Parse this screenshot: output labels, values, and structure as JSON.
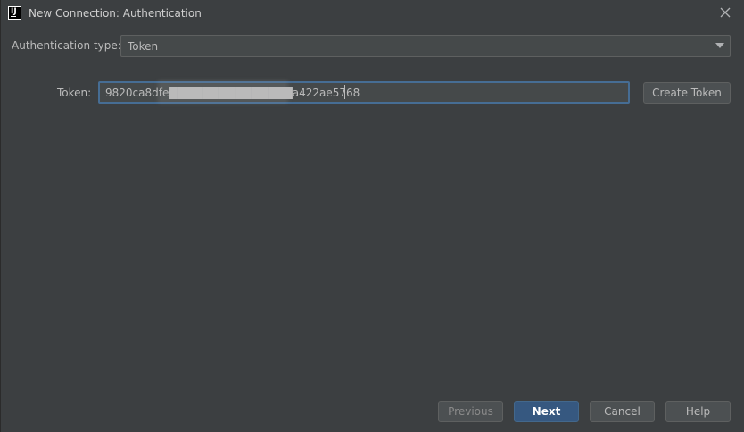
{
  "window": {
    "title": "New Connection: Authentication",
    "app_icon": "intellij-icon",
    "app_icon_text": "IJ"
  },
  "auth": {
    "label": "Authentication type:",
    "selected": "Token"
  },
  "token": {
    "label": "Token:",
    "value": "9820ca8dfe███████████████a422ae5768",
    "create_label": "Create Token"
  },
  "footer": {
    "previous_label": "Previous",
    "next_label": "Next",
    "cancel_label": "Cancel",
    "help_label": "Help"
  },
  "colors": {
    "background": "#3c3f41",
    "primary_button": "#365880",
    "focus_border": "#466d94"
  }
}
